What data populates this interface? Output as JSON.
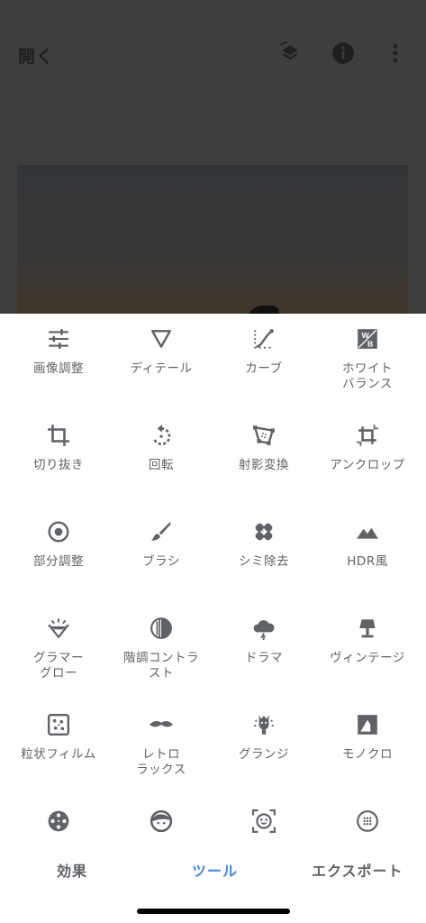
{
  "topbar": {
    "open_label": "開く",
    "icons": [
      "layers-history-icon",
      "info-icon",
      "more-vert-icon"
    ]
  },
  "tools": [
    {
      "label": "画像調整",
      "icon": "tune-icon"
    },
    {
      "label": "ディテール",
      "icon": "triangle-icon"
    },
    {
      "label": "カーブ",
      "icon": "curves-icon"
    },
    {
      "label": "ホワイト\nバランス",
      "icon": "wb-icon"
    },
    {
      "label": "切り抜き",
      "icon": "crop-icon"
    },
    {
      "label": "回転",
      "icon": "rotate-icon"
    },
    {
      "label": "射影変換",
      "icon": "perspective-icon"
    },
    {
      "label": "アンクロップ",
      "icon": "expand-icon"
    },
    {
      "label": "部分調整",
      "icon": "selective-icon"
    },
    {
      "label": "ブラシ",
      "icon": "brush-icon"
    },
    {
      "label": "シミ除去",
      "icon": "healing-icon"
    },
    {
      "label": "HDR風",
      "icon": "hdr-icon"
    },
    {
      "label": "グラマー\nグロー",
      "icon": "glamour-glow-icon"
    },
    {
      "label": "階調コントラ\nスト",
      "icon": "tonal-contrast-icon"
    },
    {
      "label": "ドラマ",
      "icon": "drama-icon"
    },
    {
      "label": "ヴィンテージ",
      "icon": "vintage-icon"
    },
    {
      "label": "粒状フィルム",
      "icon": "grainy-film-icon"
    },
    {
      "label": "レトロ\nラックス",
      "icon": "retrolux-icon"
    },
    {
      "label": "グランジ",
      "icon": "grunge-icon"
    },
    {
      "label": "モノクロ",
      "icon": "bw-icon"
    },
    {
      "label": "",
      "icon": "film-reel-icon"
    },
    {
      "label": "",
      "icon": "face-icon"
    },
    {
      "label": "",
      "icon": "face-detect-icon"
    },
    {
      "label": "",
      "icon": "frames-icon"
    }
  ],
  "bottom_nav": {
    "effects": "効果",
    "tools": "ツール",
    "export": "エクスポート",
    "active": "tools"
  },
  "colors": {
    "accent": "#4285f4",
    "icon": "#5f6368",
    "text": "#5f6368",
    "dim_background": "#3e3e3e"
  }
}
